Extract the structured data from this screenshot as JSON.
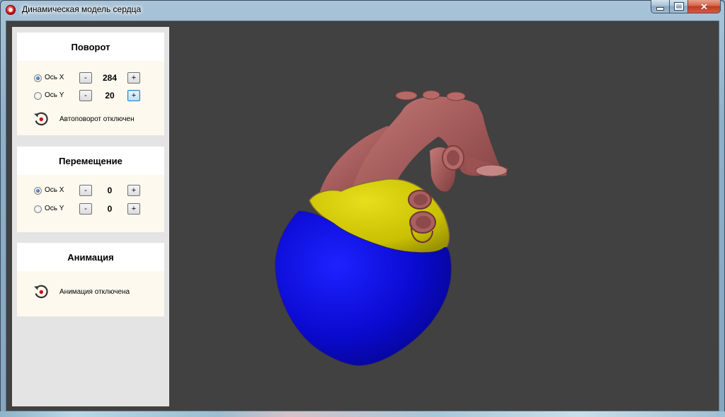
{
  "window": {
    "title": "Динамическая модель сердца",
    "minimize_icon": "minimize-icon",
    "maximize_icon": "maximize-icon",
    "close_icon": "close-icon",
    "close_glyph": "✕"
  },
  "rotation": {
    "title": "Поворот",
    "axis_x": {
      "label": "Ось X",
      "selected": true,
      "value": "284"
    },
    "axis_y": {
      "label": "Ось Y",
      "selected": false,
      "value": "20"
    },
    "minus": "-",
    "plus": "+",
    "auto_status": "Автоповорот отключен"
  },
  "movement": {
    "title": "Перемещение",
    "axis_x": {
      "label": "Ось X",
      "selected": true,
      "value": "0"
    },
    "axis_y": {
      "label": "Ось Y",
      "selected": false,
      "value": "0"
    },
    "minus": "-",
    "plus": "+"
  },
  "animation": {
    "title": "Анимация",
    "status": "Анимация отключена"
  },
  "colors": {
    "viewport_bg": "#414141",
    "ventricles": "#0a0ad0",
    "atria": "#c8c000",
    "vessels": "#a35a5a"
  }
}
